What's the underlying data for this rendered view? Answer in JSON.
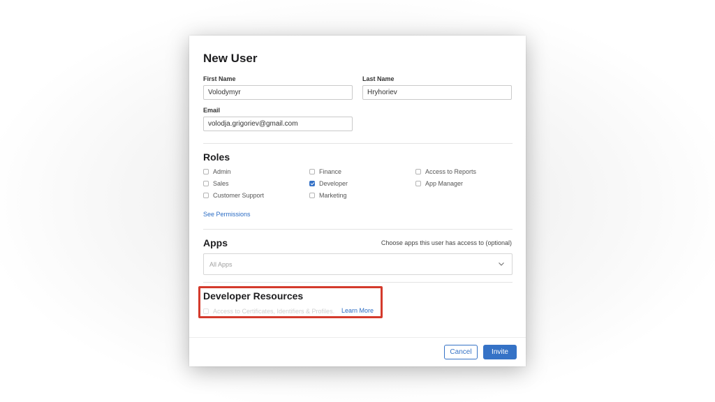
{
  "dialog": {
    "title": "New User"
  },
  "fields": {
    "first_name_label": "First Name",
    "first_name_value": "Volodymyr",
    "last_name_label": "Last Name",
    "last_name_value": "Hryhoriev",
    "email_label": "Email",
    "email_value": "volodja.grigoriev@gmail.com"
  },
  "roles": {
    "title": "Roles",
    "items": [
      {
        "label": "Admin",
        "checked": false
      },
      {
        "label": "Sales",
        "checked": false
      },
      {
        "label": "Customer Support",
        "checked": false
      },
      {
        "label": "Finance",
        "checked": false
      },
      {
        "label": "Developer",
        "checked": true
      },
      {
        "label": "Marketing",
        "checked": false
      },
      {
        "label": "Access to Reports",
        "checked": false
      },
      {
        "label": "App Manager",
        "checked": false
      }
    ],
    "see_permissions": "See Permissions"
  },
  "apps": {
    "title": "Apps",
    "hint": "Choose apps this user has access to (optional)",
    "selected": "All Apps"
  },
  "developer_resources": {
    "title": "Developer Resources",
    "option_label": "Access to Certificates, Identifiers & Profiles.",
    "learn_more": "Learn More"
  },
  "actions": {
    "cancel": "Cancel",
    "invite": "Invite"
  },
  "colors": {
    "accent": "#3572c6",
    "highlight": "#d43a2c"
  }
}
